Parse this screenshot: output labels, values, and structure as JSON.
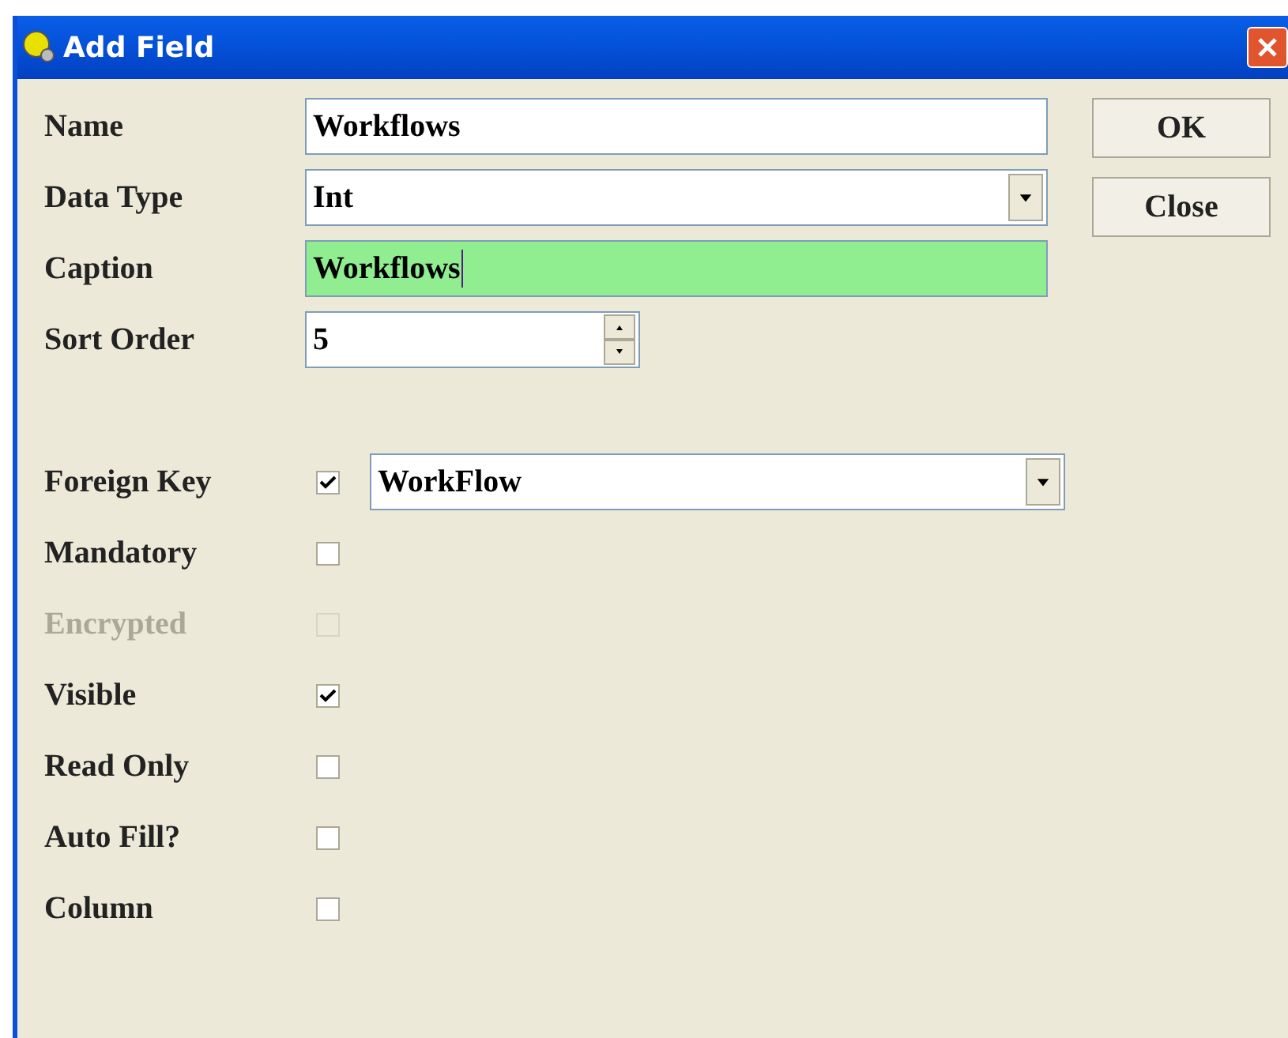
{
  "window": {
    "title": "Add Field"
  },
  "fields": [
    {
      "kind": "text",
      "label": "Name",
      "value": "Workflows",
      "highlighted": false
    },
    {
      "kind": "dropdown",
      "label": "Data Type",
      "value": "Int",
      "highlighted": false
    },
    {
      "kind": "text",
      "label": "Caption",
      "value": "Workflows",
      "highlighted": true
    },
    {
      "kind": "spinner",
      "label": "Sort Order",
      "value": "5",
      "highlighted": false
    }
  ],
  "options": [
    {
      "kind": "checkbox-combo",
      "label": "Foreign Key",
      "checked": true,
      "disabled": false,
      "value": "WorkFlow"
    },
    {
      "kind": "checkbox",
      "label": "Mandatory",
      "checked": false,
      "disabled": false
    },
    {
      "kind": "checkbox",
      "label": "Encrypted",
      "checked": false,
      "disabled": true
    },
    {
      "kind": "checkbox",
      "label": "Visible",
      "checked": true,
      "disabled": false
    },
    {
      "kind": "checkbox",
      "label": "Read Only",
      "checked": false,
      "disabled": false
    },
    {
      "kind": "checkbox",
      "label": "Auto Fill?",
      "checked": false,
      "disabled": false
    },
    {
      "kind": "checkbox",
      "label": "Column",
      "checked": false,
      "disabled": false
    }
  ],
  "buttons": [
    "OK",
    "Close"
  ]
}
